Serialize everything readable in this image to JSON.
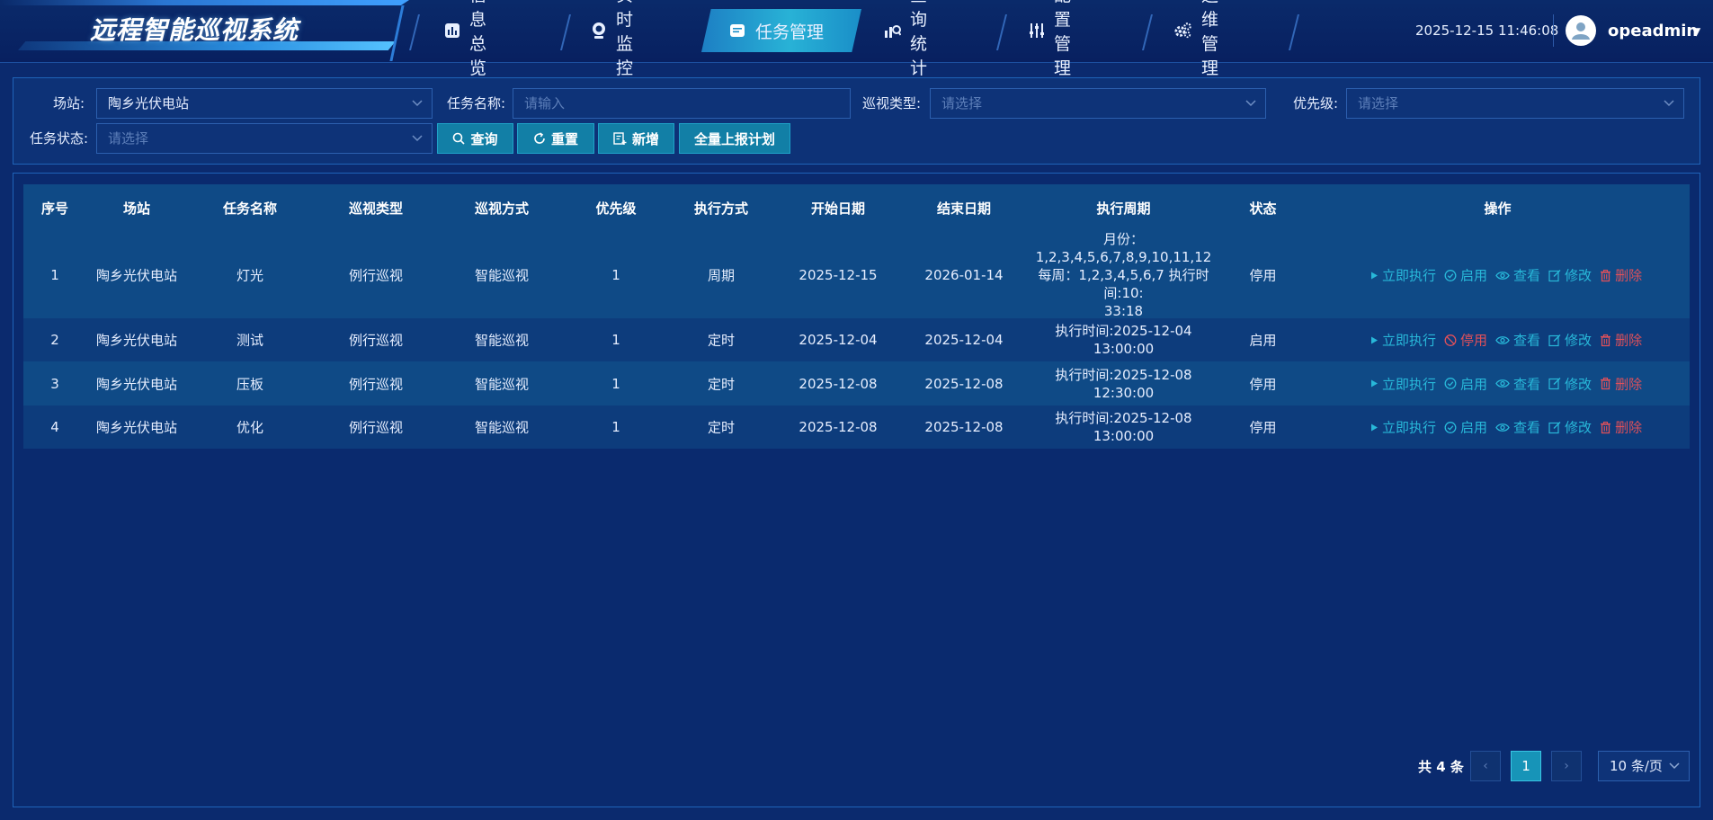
{
  "header": {
    "app_title": "远程智能巡视系统",
    "datetime": "2025-12-15 11:46:08",
    "username": "opeadmin",
    "nav": [
      {
        "label": "信息总览",
        "icon": "chart-icon"
      },
      {
        "label": "实时监控",
        "icon": "camera-icon"
      },
      {
        "label": "任务管理",
        "icon": "task-icon",
        "active": true
      },
      {
        "label": "查询统计",
        "icon": "stats-icon"
      },
      {
        "label": "配置管理",
        "icon": "sliders-icon"
      },
      {
        "label": "运维管理",
        "icon": "gears-icon"
      }
    ]
  },
  "filters": {
    "station_label": "场站:",
    "station_value": "陶乡光伏电站",
    "task_name_label": "任务名称:",
    "task_name_placeholder": "请输入",
    "patrol_type_label": "巡视类型:",
    "patrol_type_placeholder": "请选择",
    "priority_label": "优先级:",
    "priority_placeholder": "请选择",
    "task_status_label": "任务状态:",
    "task_status_placeholder": "请选择",
    "query_btn": "查询",
    "reset_btn": "重置",
    "add_btn": "新增",
    "report_btn": "全量上报计划"
  },
  "table": {
    "columns": [
      "序号",
      "场站",
      "任务名称",
      "巡视类型",
      "巡视方式",
      "优先级",
      "执行方式",
      "开始日期",
      "结束日期",
      "执行周期",
      "状态",
      "操作"
    ],
    "rows": [
      {
        "no": "1",
        "station": "陶乡光伏电站",
        "name": "灯光",
        "type": "例行巡视",
        "mode": "智能巡视",
        "priority": "1",
        "exec": "周期",
        "start": "2025-12-15",
        "end": "2026-01-14",
        "cycle_l1": "月份：1,2,3,4,5,6,7,8,9,10,11,12",
        "cycle_l2": "每周：1,2,3,4,5,6,7 执行时间:10:",
        "cycle_l3": "33:18",
        "status": "停用",
        "toggle": "启用"
      },
      {
        "no": "2",
        "station": "陶乡光伏电站",
        "name": "测试",
        "type": "例行巡视",
        "mode": "智能巡视",
        "priority": "1",
        "exec": "定时",
        "start": "2025-12-04",
        "end": "2025-12-04",
        "cycle_l1": "执行时间:2025-12-04 13:00:00",
        "status": "启用",
        "toggle": "停用"
      },
      {
        "no": "3",
        "station": "陶乡光伏电站",
        "name": "压板",
        "type": "例行巡视",
        "mode": "智能巡视",
        "priority": "1",
        "exec": "定时",
        "start": "2025-12-08",
        "end": "2025-12-08",
        "cycle_l1": "执行时间:2025-12-08 12:30:00",
        "status": "停用",
        "toggle": "启用"
      },
      {
        "no": "4",
        "station": "陶乡光伏电站",
        "name": "优化",
        "type": "例行巡视",
        "mode": "智能巡视",
        "priority": "1",
        "exec": "定时",
        "start": "2025-12-08",
        "end": "2025-12-08",
        "cycle_l1": "执行时间:2025-12-08 13:00:00",
        "status": "停用",
        "toggle": "启用"
      }
    ],
    "ops": {
      "run": "立即执行",
      "view": "查看",
      "edit": "修改",
      "delete": "删除"
    }
  },
  "pagination": {
    "total": "共 4 条",
    "current_page": "1",
    "page_size": "10 条/页"
  },
  "colors": {
    "accent": "#28b8d9",
    "danger": "#e0505a",
    "bg": "#0b2a6e"
  }
}
